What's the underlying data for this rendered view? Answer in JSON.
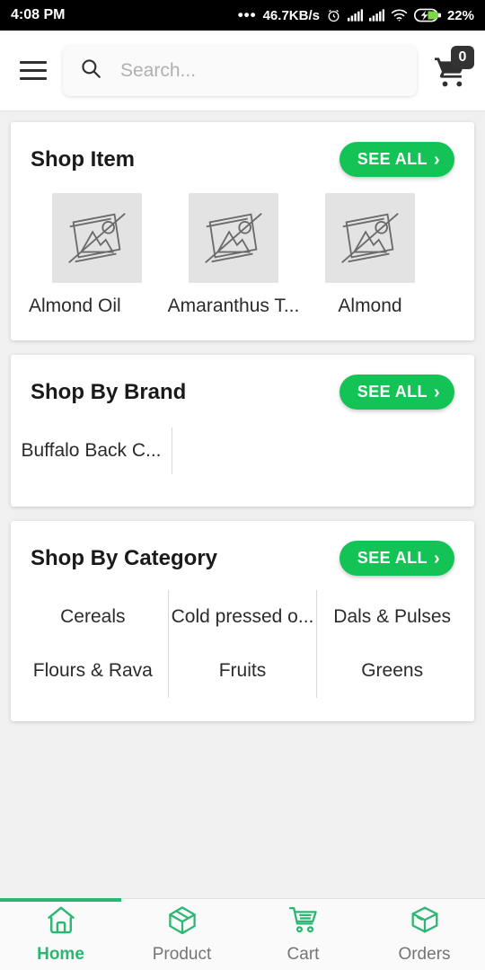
{
  "status_bar": {
    "time": "4:08 PM",
    "dots": "•••",
    "network_speed": "46.7KB/s",
    "alarm_icon": "alarm-clock-icon",
    "signal_one_icon": "signal-bars-icon",
    "signal_two_icon": "signal-bars-icon",
    "wifi_icon": "wifi-icon",
    "battery_icon": "battery-charging-icon",
    "battery_percent": "22%"
  },
  "header": {
    "menu_icon": "hamburger-menu-icon",
    "search_icon": "search-icon",
    "search_value": "",
    "search_placeholder": "Search...",
    "cart_icon": "shopping-cart-icon",
    "cart_badge": "0"
  },
  "sections": [
    {
      "id": "shop-item",
      "title": "Shop Item",
      "see_all_label": "SEE ALL",
      "see_all_chevron": "chevron-right-icon",
      "items": [
        {
          "label": "Almond Oil",
          "thumb_icon": "broken-image-icon"
        },
        {
          "label": "Amaranthus T...",
          "thumb_icon": "broken-image-icon"
        },
        {
          "label": "Almond",
          "thumb_icon": "broken-image-icon"
        }
      ]
    },
    {
      "id": "shop-by-brand",
      "title": "Shop By Brand",
      "see_all_label": "SEE ALL",
      "see_all_chevron": "chevron-right-icon",
      "brands": [
        "Buffalo Back C..."
      ]
    },
    {
      "id": "shop-by-category",
      "title": "Shop By Category",
      "see_all_label": "SEE ALL",
      "see_all_chevron": "chevron-right-icon",
      "categories": [
        "Cereals",
        "Cold pressed o...",
        "Dals & Pulses",
        "Flours & Rava",
        "Fruits",
        "Greens"
      ]
    }
  ],
  "bottom_nav": {
    "active_index": 0,
    "items": [
      {
        "label": "Home",
        "icon": "home-icon"
      },
      {
        "label": "Product",
        "icon": "box-package-icon"
      },
      {
        "label": "Cart",
        "icon": "shopping-cart-icon"
      },
      {
        "label": "Orders",
        "icon": "parcel-box-icon"
      }
    ]
  },
  "colors": {
    "accent_green": "#14c356",
    "nav_active_green": "#2bb673",
    "page_background": "#f0f0f0",
    "card_background": "#ffffff",
    "status_bar_background": "#000000"
  }
}
